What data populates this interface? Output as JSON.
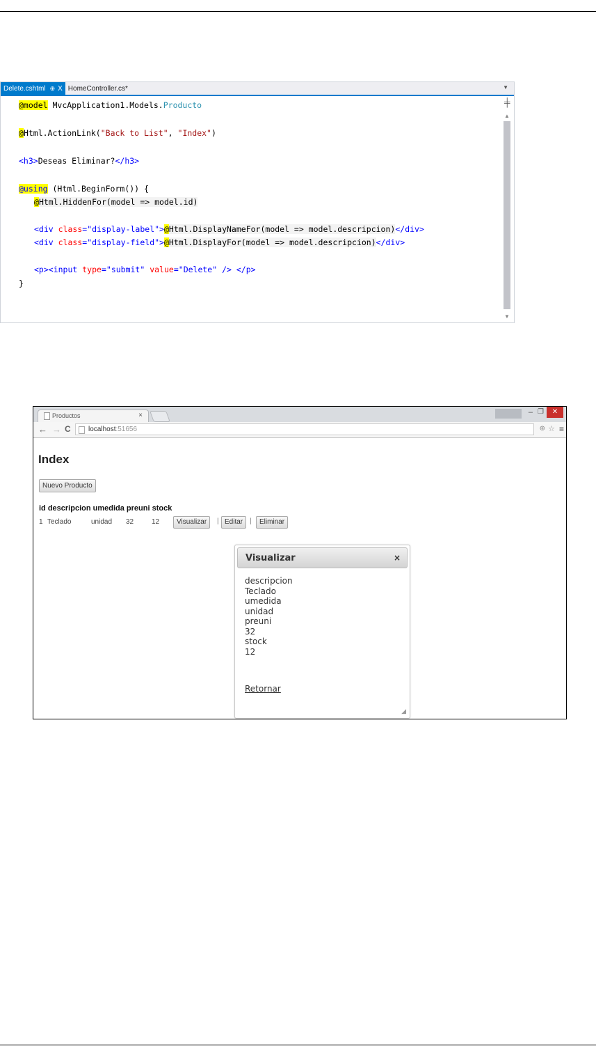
{
  "ide": {
    "tabs": [
      {
        "label": "Delete.cshtml",
        "pin": "⊕",
        "close": "X"
      },
      {
        "label": "HomeController.cs*"
      }
    ],
    "code": {
      "l1": {
        "razor": "@model",
        "ns": " MvcApplication1.Models.",
        "type": "Producto"
      },
      "l2": {
        "razor": "@",
        "call": "Html.ActionLink(",
        "s1": "\"Back to List\"",
        "comma": ", ",
        "s2": "\"Index\"",
        "close": ")"
      },
      "l3": {
        "open": "<h3>",
        "text": "Deseas Eliminar?",
        "close": "</h3>"
      },
      "l4": {
        "razor": "@using",
        "rest": " (Html.BeginForm()) {"
      },
      "l5": {
        "razor": "@",
        "rest": "Html.HiddenFor(model => model.id)"
      },
      "l6": {
        "open": "<div ",
        "attr": "class",
        "eq": "=",
        "val": "\"display-label\"",
        "gt": ">",
        "razor": "@",
        "expr": "Html.DisplayNameFor(model => model.descripcion)",
        "close": "</div>"
      },
      "l7": {
        "open": "<div ",
        "attr": "class",
        "eq": "=",
        "val": "\"display-field\"",
        "gt": ">",
        "razor": "@",
        "expr": "Html.DisplayFor(model => model.descripcion)",
        "close": "</div>"
      },
      "l8": {
        "p": "<p>",
        "open": "<input ",
        "a1": "type",
        "eq": "=",
        "v1": "\"submit\"",
        "a2": " value",
        "v2": "\"Delete\"",
        "end": " /> ",
        "pc": "</p>"
      },
      "l9": {
        "text": "}"
      }
    }
  },
  "browser": {
    "tab_title": "Productos",
    "tab_close": "×",
    "url_host": "localhost",
    "url_port": ":51656",
    "page": {
      "title": "Index",
      "new_button": "Nuevo Producto",
      "table_header": "id descripcion umedida preuni stock",
      "row": {
        "id": "1",
        "descripcion": "Teclado",
        "umedida": "unidad",
        "preuni": "32",
        "stock": "12",
        "actions": [
          "Visualizar",
          "Editar",
          "Eliminar"
        ],
        "separator": "|"
      }
    },
    "dialog": {
      "title": "Visualizar",
      "close": "×",
      "lines": [
        "descripcion",
        "Teclado",
        "umedida",
        "unidad",
        "preuni",
        "32",
        "stock",
        "12"
      ],
      "link": "Retornar"
    }
  },
  "icons": {
    "back": "back-arrow-icon",
    "forward": "forward-arrow-icon",
    "reload": "reload-icon",
    "star": "star-icon",
    "menu": "hamburger-menu-icon"
  },
  "colors": {
    "ide_accent": "#007acc",
    "razor_highlight": "#ffff00",
    "window_close": "#c9302c"
  }
}
